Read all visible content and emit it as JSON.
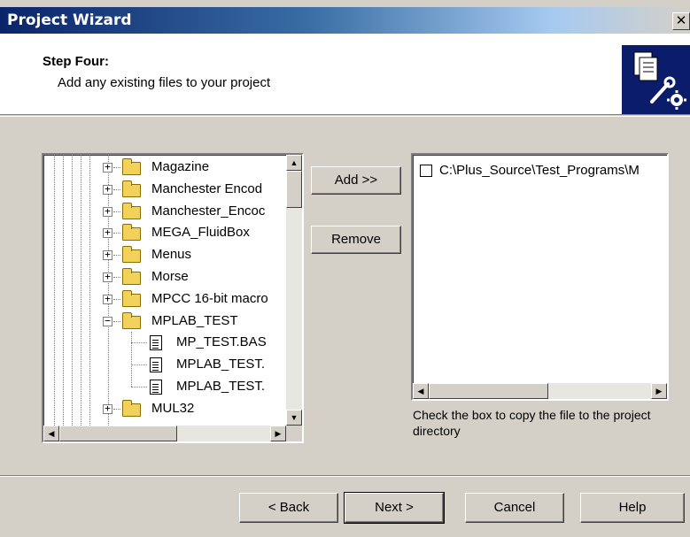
{
  "window": {
    "title": "Project Wizard",
    "close_glyph": "✕"
  },
  "header": {
    "step_title": "Step Four:",
    "step_description": "Add any existing files to your project",
    "icon": "wizard-files-gear-icon"
  },
  "tree": {
    "items": [
      {
        "label": "Magazine",
        "type": "folder",
        "expander": "+"
      },
      {
        "label": "Manchester Encod",
        "type": "folder",
        "expander": "+"
      },
      {
        "label": "Manchester_Encoc",
        "type": "folder",
        "expander": "+"
      },
      {
        "label": "MEGA_FluidBox",
        "type": "folder",
        "expander": "+"
      },
      {
        "label": "Menus",
        "type": "folder",
        "expander": "+"
      },
      {
        "label": "Morse",
        "type": "folder",
        "expander": "+"
      },
      {
        "label": "MPCC 16-bit macro",
        "type": "folder",
        "expander": "+"
      },
      {
        "label": "MPLAB_TEST",
        "type": "folder",
        "expander": "−"
      },
      {
        "label": "MP_TEST.BAS",
        "type": "file"
      },
      {
        "label": "MPLAB_TEST.",
        "type": "file"
      },
      {
        "label": "MPLAB_TEST.",
        "type": "file"
      },
      {
        "label": "MUL32",
        "type": "folder",
        "expander": "+"
      }
    ]
  },
  "buttons": {
    "add": "Add >>",
    "remove": "Remove",
    "back": "< Back",
    "next": "Next >",
    "cancel": "Cancel",
    "help": "Help"
  },
  "file_list": {
    "items": [
      {
        "path": "C:\\Plus_Source\\Test_Programs\\M",
        "checked": false
      }
    ]
  },
  "hint": "Check the box to copy the file to the project directory",
  "scroll_glyphs": {
    "up": "▲",
    "down": "▼",
    "left": "◀",
    "right": "▶"
  }
}
